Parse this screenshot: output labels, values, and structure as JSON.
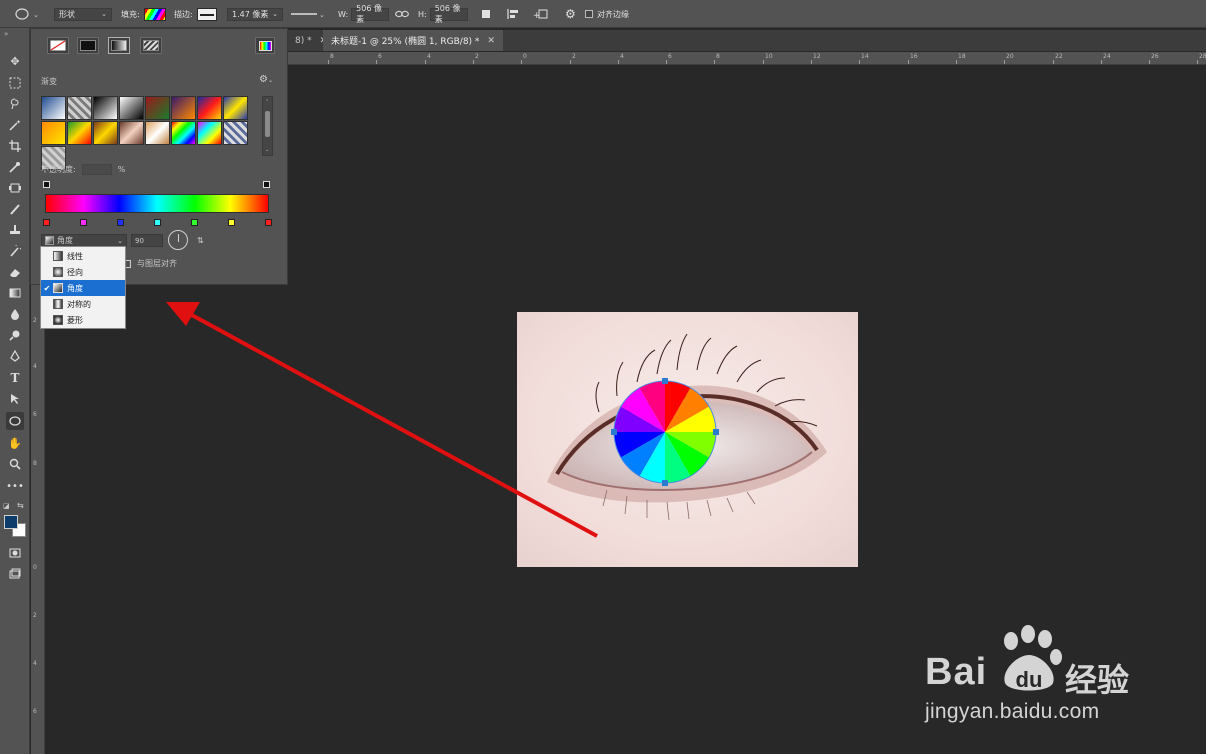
{
  "options_bar": {
    "shape_mode": "形状",
    "fill_label": "填充:",
    "stroke_label": "描边:",
    "stroke_width": "1.47 像素",
    "w_label": "W:",
    "w_value": "506 像素",
    "h_label": "H:",
    "h_value": "506 像素",
    "align_edges_label": "对齐边缘"
  },
  "tabs": [
    {
      "label": "8) *",
      "active": false
    },
    {
      "label": "未标题-1 @ 25% (椭圆 1, RGB/8) *",
      "active": true
    }
  ],
  "ruler": {
    "horizontal": [
      "8",
      "6",
      "4",
      "2",
      "0",
      "2",
      "4",
      "6",
      "8",
      "10",
      "12",
      "14",
      "16",
      "18",
      "20",
      "22",
      "24",
      "26",
      "28"
    ],
    "vertical": [
      "2",
      "4",
      "6",
      "8",
      "0",
      "2",
      "4",
      "6"
    ]
  },
  "gradient_panel": {
    "title": "渐变",
    "opacity_label": "不透明度:",
    "opacity_unit": "%",
    "gradient_type": "角度",
    "angle_value": "90",
    "align_with_layer_label": "与图层对齐",
    "swatches": [
      "linear-gradient(135deg,#1e4b8f,#ffffff)",
      "repeating-linear-gradient(45deg,#cfcfcf 0 3px,#7a7a7a 3px 6px)",
      "linear-gradient(135deg,#000000,#ffffff)",
      "linear-gradient(135deg,#ffffff,#000000)",
      "linear-gradient(135deg,#9a1b1b,#1b7a2b)",
      "linear-gradient(135deg,#3a1a6a,#ff8a00)",
      "linear-gradient(135deg,#1a2aa0,#ff1a1a,#ffd700)",
      "linear-gradient(135deg,#2a3ab0,#ffe600,#2a3ab0)",
      "linear-gradient(135deg,#ff8a00,#ffe600)",
      "linear-gradient(135deg,#1a9a2a,#ffd700,#ff0000)",
      "linear-gradient(135deg,#7a3a1a,#ffd700,#7a3a1a)",
      "linear-gradient(135deg,#6a3a2a,#f2d0c0,#6a3a2a)",
      "linear-gradient(135deg,#e0a060,#ffffff,#c08040)",
      "linear-gradient(135deg,#ff0000,#ffff00,#00ff00,#00ffff,#0000ff,#ff00ff)",
      "linear-gradient(135deg,#ff00ff,#00ffff,#ffff00,#ff0000)",
      "repeating-linear-gradient(45deg,#dcdcdc 0 3px,#5a6a9a 3px 6px)",
      "repeating-linear-gradient(45deg,#cfcfcf 0 3px,#9a9a9a 3px 6px)"
    ],
    "gradient_bar": "linear-gradient(90deg,#ff0000 0%,#ff00ff 17%,#0000ff 33%,#00ffff 50%,#00ff00 67%,#ffff00 83%,#ff0000 100%)",
    "color_stops": [
      "#ff2020",
      "#ff30ff",
      "#2030ff",
      "#30ffff",
      "#30ff30",
      "#ffff30",
      "#ff2020"
    ]
  },
  "dropdown": {
    "items": [
      {
        "label": "线性",
        "selected": false
      },
      {
        "label": "径向",
        "selected": false
      },
      {
        "label": "角度",
        "selected": true
      },
      {
        "label": "对称的",
        "selected": false
      },
      {
        "label": "菱形",
        "selected": false
      }
    ]
  },
  "colors": {
    "foreground": "#0d3b6a",
    "background": "#ffffff",
    "arrow": "#e01010"
  },
  "watermark": {
    "brand": "Bai",
    "brand_cn": "经验",
    "url": "jingyan.baidu.com"
  }
}
